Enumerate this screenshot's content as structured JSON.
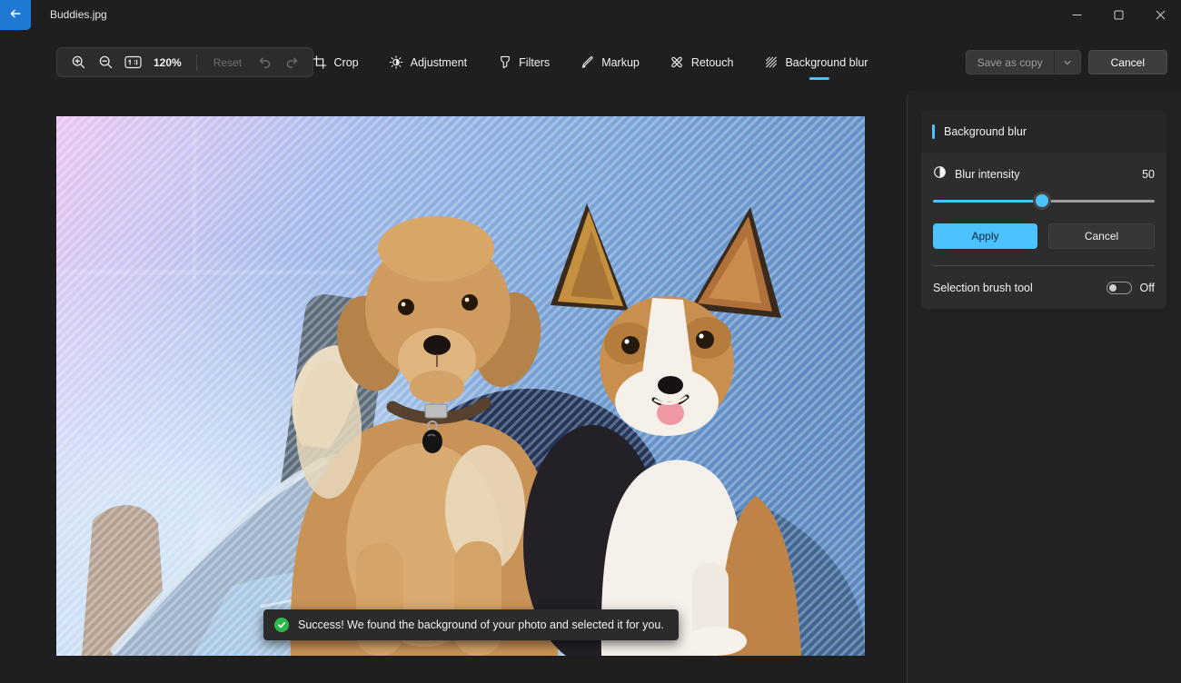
{
  "window": {
    "title": "Buddies.jpg"
  },
  "toolbar": {
    "zoom_level": "120%",
    "reset_label": "Reset"
  },
  "tabs": [
    {
      "label": "Crop",
      "active": false
    },
    {
      "label": "Adjustment",
      "active": false
    },
    {
      "label": "Filters",
      "active": false
    },
    {
      "label": "Markup",
      "active": false
    },
    {
      "label": "Retouch",
      "active": false
    },
    {
      "label": "Background blur",
      "active": true
    }
  ],
  "header_actions": {
    "save_as_copy_label": "Save as copy",
    "cancel_label": "Cancel"
  },
  "panel": {
    "title": "Background blur",
    "blur_intensity": {
      "label": "Blur intensity",
      "value": "50",
      "percent": 49
    },
    "apply_label": "Apply",
    "cancel_label": "Cancel",
    "brush": {
      "label": "Selection brush tool",
      "state": "Off"
    }
  },
  "toast": {
    "message": "Success! We found the background of your photo and selected it for you."
  },
  "photo": {
    "alt": "Two puppies, a goldendoodle and a corgi, sitting on a blue armchair; background covered by diagonal-stripe selection overlay"
  },
  "colors": {
    "accent": "#4CC2FF",
    "back_button_blue": "#1F7AD4",
    "success_green": "#2DB84D",
    "window_bg": "#1F1F1F",
    "card_bg": "#2D2D2D"
  },
  "icons": {
    "minimize": "–",
    "maximize": "▢",
    "close": "✕",
    "back": "←",
    "chevron_down": "⌄",
    "check": "✓"
  }
}
